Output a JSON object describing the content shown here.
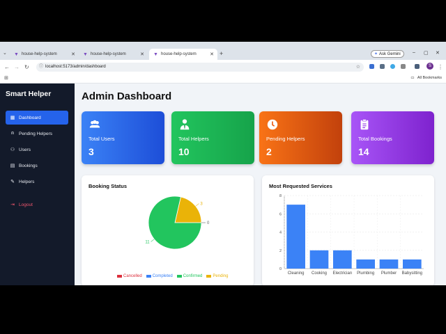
{
  "browser": {
    "tabs": [
      {
        "label": "house-help-system"
      },
      {
        "label": "house-help-system"
      },
      {
        "label": "house-help-system"
      }
    ],
    "ask_gemini": "Ask Gemini",
    "url": "localhost:5173/admin/dashboard",
    "all_bookmarks": "All Bookmarks",
    "profile_initial": "S"
  },
  "sidebar": {
    "brand": "Smart Helper",
    "items": [
      {
        "label": "Dashboard",
        "icon": "grid-icon"
      },
      {
        "label": "Pending Helpers",
        "icon": "user-clock-icon"
      },
      {
        "label": "Users",
        "icon": "users-icon"
      },
      {
        "label": "Bookings",
        "icon": "clipboard-icon"
      },
      {
        "label": "Helpers",
        "icon": "wrench-icon"
      }
    ],
    "logout": "Logout"
  },
  "main": {
    "title": "Admin Dashboard",
    "stats": [
      {
        "label": "Total Users",
        "value": "3",
        "icon": "users-icon",
        "color_from": "#3b82f6",
        "color_to": "#1d4ed8"
      },
      {
        "label": "Total Helpers",
        "value": "10",
        "icon": "user-tie-icon",
        "color_from": "#22c55e",
        "color_to": "#16a34a"
      },
      {
        "label": "Pending Helpers",
        "value": "2",
        "icon": "clock-icon",
        "color_from": "#f97316",
        "color_to": "#c2410c"
      },
      {
        "label": "Total Bookings",
        "value": "14",
        "icon": "clipboard-list-icon",
        "color_from": "#a855f7",
        "color_to": "#7e22ce"
      }
    ]
  },
  "chart_data": [
    {
      "type": "pie",
      "title": "Booking Status",
      "categories": [
        "Cancelled",
        "Completed",
        "Confirmed",
        "Pending"
      ],
      "values": [
        0,
        0,
        11,
        3
      ],
      "colors": [
        "#dc2f3c",
        "#3b82f6",
        "#22c55e",
        "#eab308"
      ],
      "slice_labels": [
        "3",
        "0",
        "11"
      ],
      "legend": "bottom"
    },
    {
      "type": "bar",
      "title": "Most Requested Services",
      "categories": [
        "Cleaning",
        "Cooking",
        "Electrician",
        "Plumbing",
        "Plumber",
        "Babysitting"
      ],
      "values": [
        7,
        2,
        2,
        1,
        1,
        1
      ],
      "color": "#3b82f6",
      "ylim": [
        0,
        8
      ],
      "yticks": [
        "0",
        "2",
        "4",
        "6",
        "8"
      ],
      "grid": true
    }
  ]
}
